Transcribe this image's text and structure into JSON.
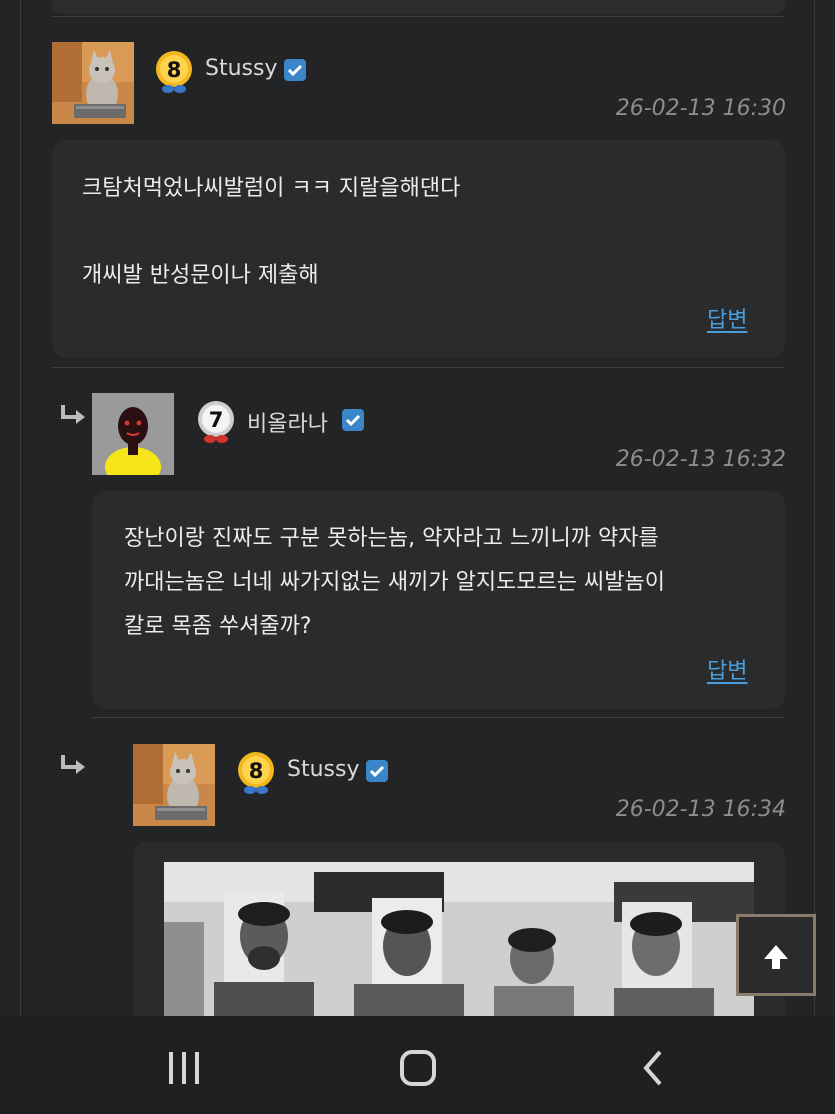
{
  "comments": [
    {
      "author": "Stussy",
      "level": "8",
      "timestamp": "26-02-13 16:30",
      "lines": [
        "크탐처먹었나씨발럼이 ㅋㅋ 지랄을해댄다",
        "개씨발 반성문이나 제출해"
      ],
      "reply_label": "답변"
    },
    {
      "author": "비올라나",
      "level": "7",
      "timestamp": "26-02-13 16:32",
      "lines": [
        "장난이랑 진짜도 구분 못하는놈, 약자라고 느끼니까 약자를",
        "까대는놈은 너네 싸가지없는 새끼가 알지도모르는 씨발놈이",
        "칼로 목좀 쑤셔줄까?"
      ],
      "reply_label": "답변"
    },
    {
      "author": "Stussy",
      "level": "8",
      "timestamp": "26-02-13 16:34"
    }
  ],
  "icons": {
    "reply_arrow": "reply-arrow-icon",
    "verified": "check-badge-icon",
    "scroll_top": "arrow-up-icon"
  },
  "colors": {
    "background": "#232425",
    "bubble": "#2a2b2d",
    "link": "#4a9edb",
    "verified": "#3b86c9",
    "level8": "#f2b81d",
    "level7": "#e6e6e6"
  }
}
